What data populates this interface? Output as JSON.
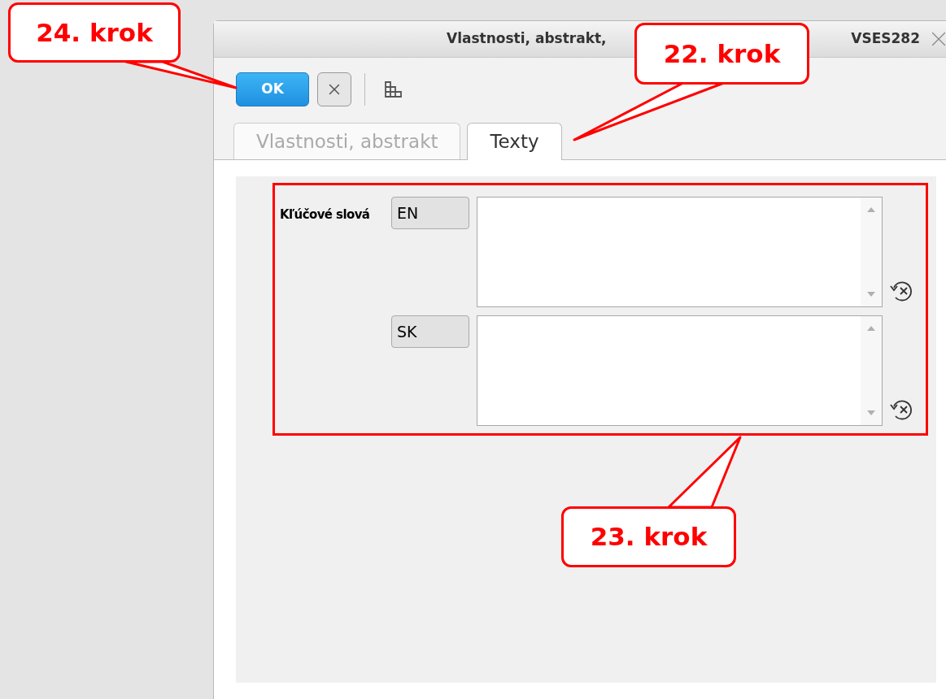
{
  "window": {
    "title": "Vlastnosti, abstrakt,",
    "record_code": "VSES282"
  },
  "toolbar": {
    "ok_label": "OK"
  },
  "tabs": [
    {
      "label": "Vlastnosti, abstrakt",
      "selected": false
    },
    {
      "label": "Texty",
      "selected": true
    }
  ],
  "form": {
    "label": "Kľúčové slová",
    "fields": [
      {
        "language": "EN"
      },
      {
        "language": "SK"
      }
    ]
  },
  "annotations": [
    {
      "text": "24. krok"
    },
    {
      "text": "22. krok"
    },
    {
      "text": "23. krok"
    }
  ]
}
